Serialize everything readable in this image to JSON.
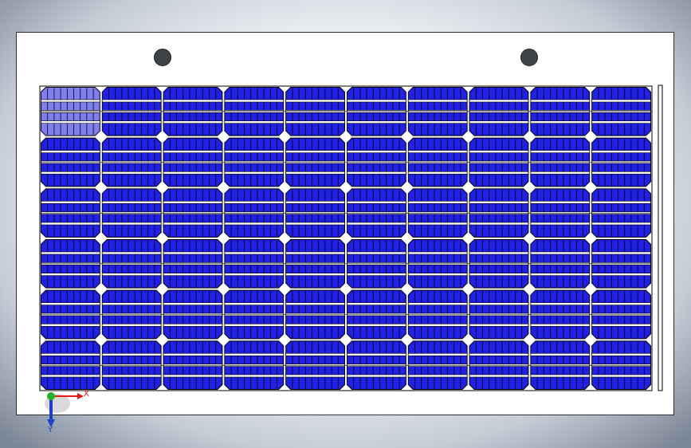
{
  "viewport": {
    "background_color": "#ffffff",
    "edge_color": "#7a8595"
  },
  "panel": {
    "sheet_color": "#ffffff",
    "cell_color": "#2020e6",
    "highlight_cell_color": "#7f7ff0",
    "line_color": "#000000",
    "columns": 10,
    "rows": 6
  },
  "mounting_holes": [
    "hole-left",
    "hole-right"
  ],
  "triad": {
    "x_label": "X",
    "y_label": "Y",
    "x_color": "#e31b1b",
    "y_color": "#1b3fd0",
    "z_color": "#22b422"
  }
}
